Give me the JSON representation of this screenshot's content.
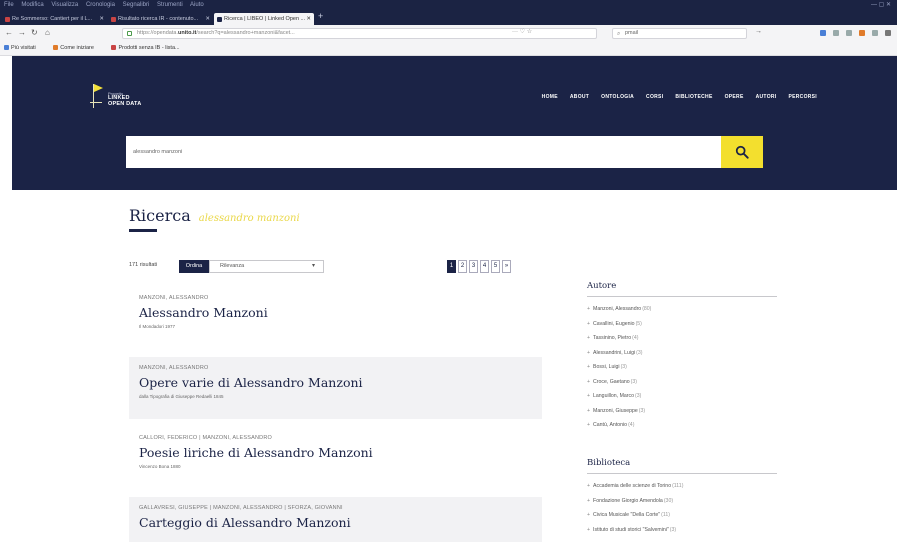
{
  "browser": {
    "menu": [
      "File",
      "Modifica",
      "Visualizza",
      "Cronologia",
      "Segnalibri",
      "Strumenti",
      "Aiuto"
    ],
    "tabs": [
      {
        "label": "Re Sommerso: Cantiert per il L..."
      },
      {
        "label": "Risultato ricerca IR - contenuto..."
      },
      {
        "label": "Ricerca | LIBEO | Linked Open ..."
      }
    ],
    "url_prefix": "https://opendata.",
    "url_domain": "unito.it",
    "url_suffix": "/search?q=alessandro+manzoni&facet...",
    "websearch_value": "pmail",
    "bookmarks": [
      "Più visitati",
      "Come iniziare",
      "Prodotti senza IB - lista..."
    ]
  },
  "site": {
    "logo_sup": "Progetto",
    "logo_line1": "LINKED",
    "logo_line2": "OPEN DATA",
    "nav": [
      "HOME",
      "ABOUT",
      "ONTOLOGIA",
      "CORSI",
      "BIBLIOTECHE",
      "OPERE",
      "AUTORI",
      "PERCORSI"
    ],
    "search_value": "alessandro manzoni"
  },
  "page": {
    "heading": "Ricerca",
    "query": "alessandro manzoni",
    "count": "171 risultati",
    "sort_label": "Ordina",
    "sort_value": "Rilevanza",
    "pages": [
      "1",
      "2",
      "3",
      "4",
      "5",
      "»"
    ]
  },
  "results": [
    {
      "authors": "MANZONI, ALESSANDRO",
      "title": "Alessandro Manzoni",
      "publication": "Il Mondadori 1977"
    },
    {
      "authors": "MANZONI, ALESSANDRO",
      "title": "Opere varie di Alessandro Manzoni",
      "publication": "dalla Tipografia di Giuseppe Redaelli 1845"
    },
    {
      "authors": "CALLORI, FEDERICO | MANZONI, ALESSANDRO",
      "title": "Poesie liriche di Alessandro Manzoni",
      "publication": "Vincenzo Bona 1880"
    },
    {
      "authors": "GALLAVRESI, GIUSEPPE | MANZONI, ALESSANDRO | SFORZA, GIOVANNI",
      "title": "Carteggio di Alessandro Manzoni",
      "publication": ""
    }
  ],
  "facets": {
    "author_title": "Autore",
    "authors": [
      {
        "name": "Manzoni, Alessandro",
        "count": "(80)"
      },
      {
        "name": "Cavallini, Eugenio",
        "count": "(5)"
      },
      {
        "name": "Tassinino, Pietro",
        "count": "(4)"
      },
      {
        "name": "Alessandrini, Luigi",
        "count": "(3)"
      },
      {
        "name": "Bossi, Luigi",
        "count": "(3)"
      },
      {
        "name": "Croce, Gaetano",
        "count": "(3)"
      },
      {
        "name": "Languillon, Marco",
        "count": "(3)"
      },
      {
        "name": "Manzoni, Giuseppe",
        "count": "(3)"
      },
      {
        "name": "Cantù, Antonio",
        "count": "(4)"
      }
    ],
    "library_title": "Biblioteca",
    "libraries": [
      {
        "name": "Accademia delle scienze di Torino",
        "count": "(111)"
      },
      {
        "name": "Fondazione Giorgio Amendola",
        "count": "(30)"
      },
      {
        "name": "Civica Musicale \"Della Corte\"",
        "count": "(11)"
      },
      {
        "name": "Istituto di studi storici \"Salvemini\"",
        "count": "(3)"
      }
    ]
  },
  "colors": {
    "navy": "#1b2346",
    "accent": "#f3df2e"
  }
}
